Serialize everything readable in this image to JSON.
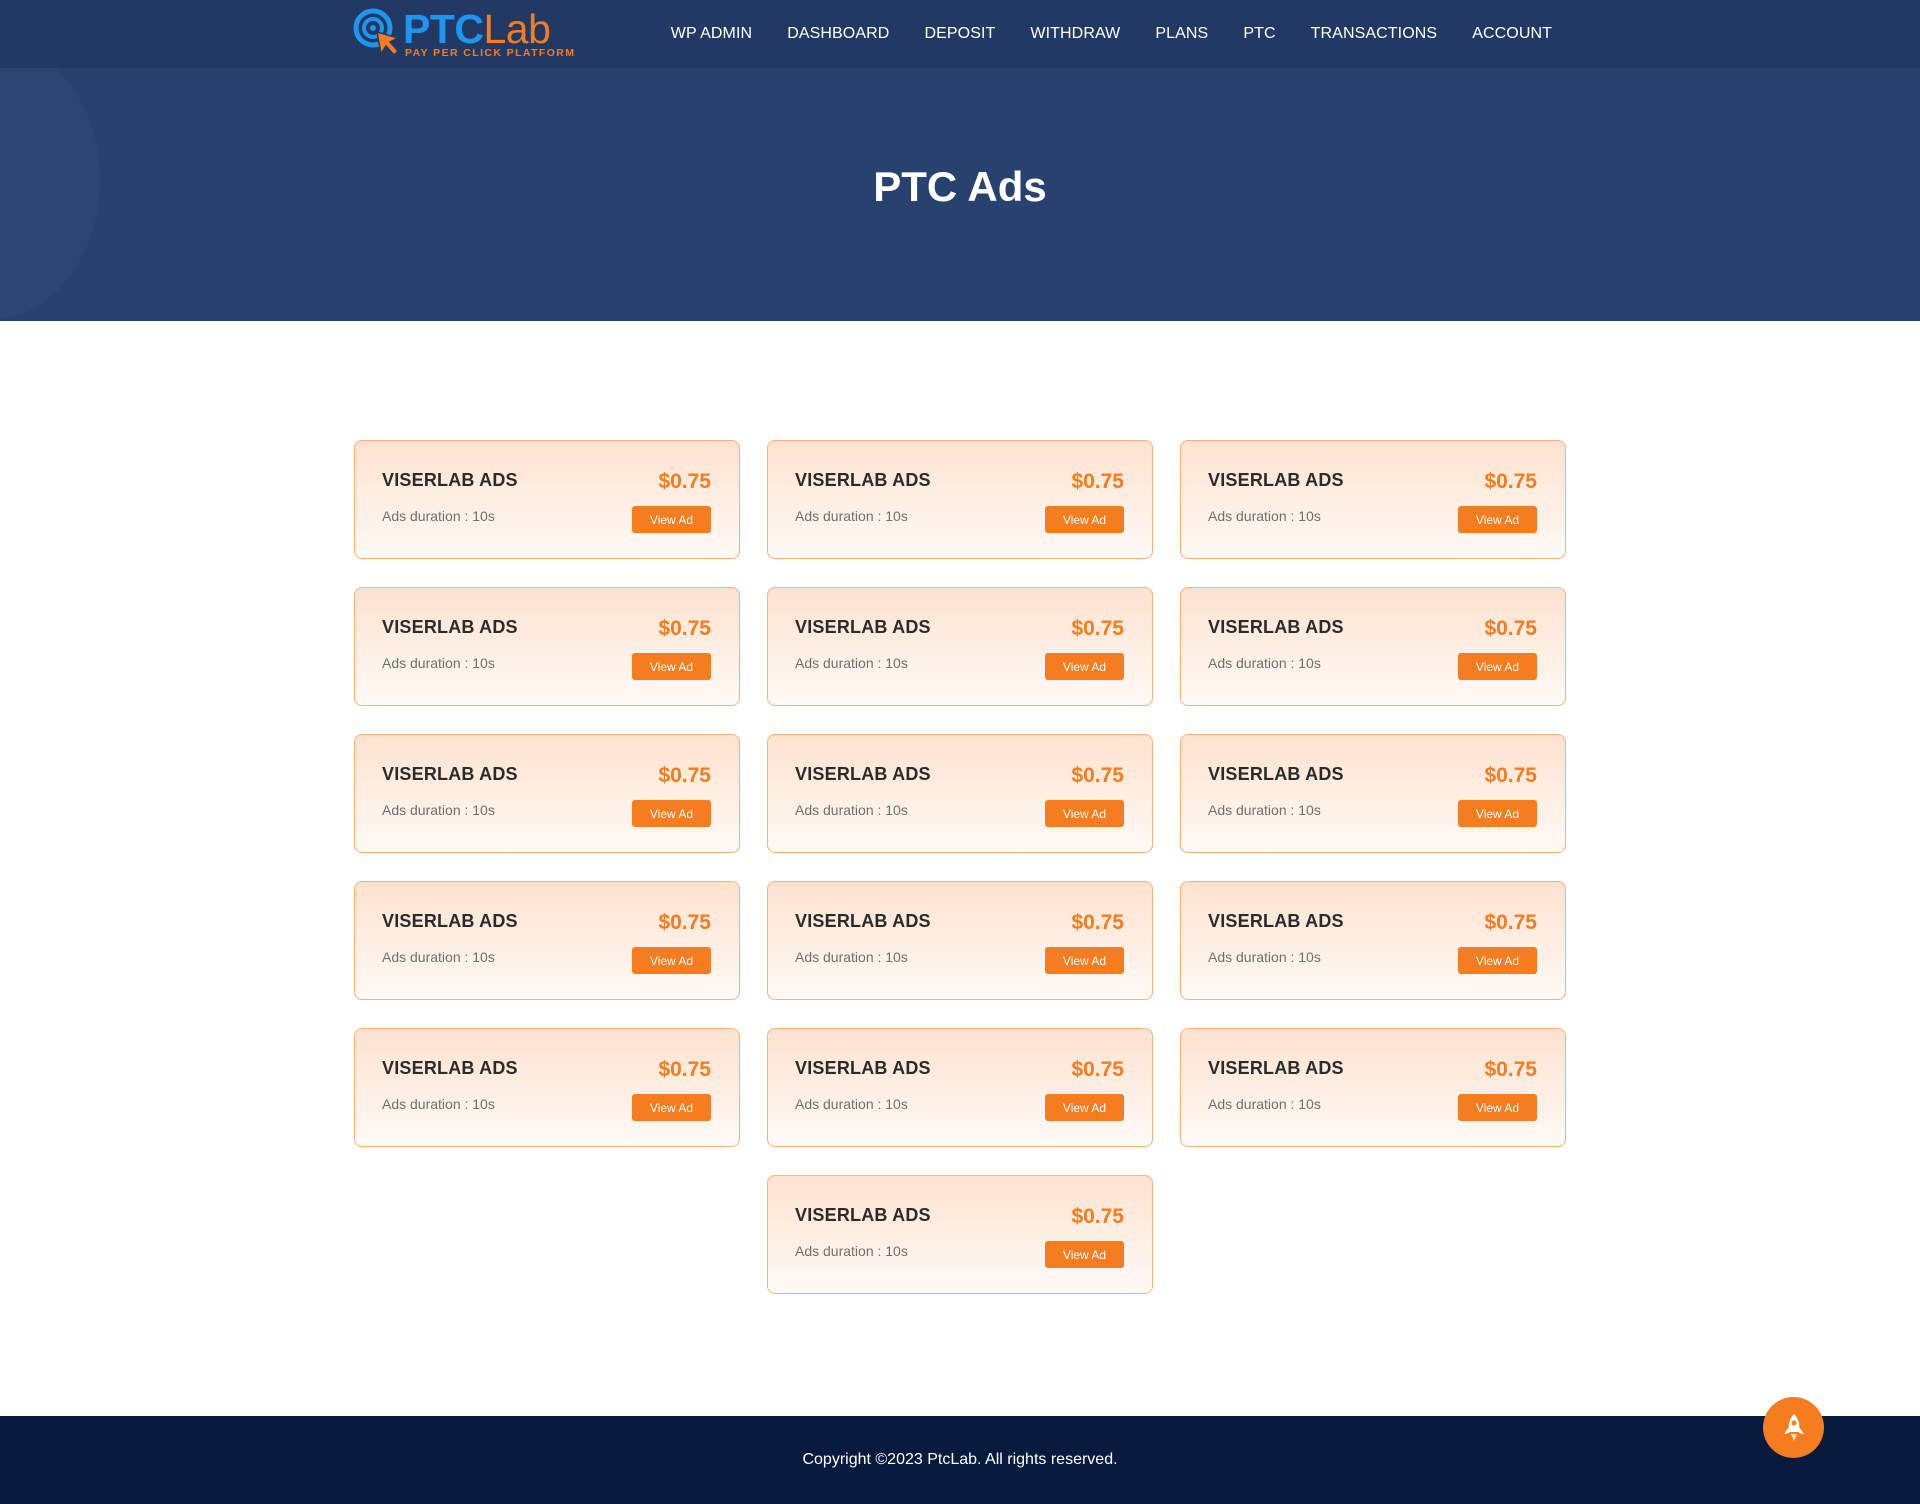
{
  "brand": {
    "name_part1": "PTC",
    "name_part2": "Lab",
    "tagline": "PAY PER CLICK PLATFORM",
    "blue": "#1e96f0",
    "orange": "#f57c1f"
  },
  "nav": {
    "items": [
      {
        "label": "WP ADMIN"
      },
      {
        "label": "DASHBOARD"
      },
      {
        "label": "DEPOSIT"
      },
      {
        "label": "WITHDRAW"
      },
      {
        "label": "PLANS"
      },
      {
        "label": "PTC"
      },
      {
        "label": "TRANSACTIONS"
      },
      {
        "label": "ACCOUNT"
      }
    ]
  },
  "hero": {
    "title": "PTC Ads"
  },
  "ads": [
    {
      "title": "VISERLAB ADS",
      "duration": "Ads duration : 10s",
      "price": "$0.75",
      "button": "View Ad"
    },
    {
      "title": "VISERLAB ADS",
      "duration": "Ads duration : 10s",
      "price": "$0.75",
      "button": "View Ad"
    },
    {
      "title": "VISERLAB ADS",
      "duration": "Ads duration : 10s",
      "price": "$0.75",
      "button": "View Ad"
    },
    {
      "title": "VISERLAB ADS",
      "duration": "Ads duration : 10s",
      "price": "$0.75",
      "button": "View Ad"
    },
    {
      "title": "VISERLAB ADS",
      "duration": "Ads duration : 10s",
      "price": "$0.75",
      "button": "View Ad"
    },
    {
      "title": "VISERLAB ADS",
      "duration": "Ads duration : 10s",
      "price": "$0.75",
      "button": "View Ad"
    },
    {
      "title": "VISERLAB ADS",
      "duration": "Ads duration : 10s",
      "price": "$0.75",
      "button": "View Ad"
    },
    {
      "title": "VISERLAB ADS",
      "duration": "Ads duration : 10s",
      "price": "$0.75",
      "button": "View Ad"
    },
    {
      "title": "VISERLAB ADS",
      "duration": "Ads duration : 10s",
      "price": "$0.75",
      "button": "View Ad"
    },
    {
      "title": "VISERLAB ADS",
      "duration": "Ads duration : 10s",
      "price": "$0.75",
      "button": "View Ad"
    },
    {
      "title": "VISERLAB ADS",
      "duration": "Ads duration : 10s",
      "price": "$0.75",
      "button": "View Ad"
    },
    {
      "title": "VISERLAB ADS",
      "duration": "Ads duration : 10s",
      "price": "$0.75",
      "button": "View Ad"
    },
    {
      "title": "VISERLAB ADS",
      "duration": "Ads duration : 10s",
      "price": "$0.75",
      "button": "View Ad"
    },
    {
      "title": "VISERLAB ADS",
      "duration": "Ads duration : 10s",
      "price": "$0.75",
      "button": "View Ad"
    },
    {
      "title": "VISERLAB ADS",
      "duration": "Ads duration : 10s",
      "price": "$0.75",
      "button": "View Ad"
    },
    {
      "title": "VISERLAB ADS",
      "duration": "Ads duration : 10s",
      "price": "$0.75",
      "button": "View Ad"
    }
  ],
  "footer": {
    "copyright": "Copyright ©2023 PtcLab. All rights reserved."
  },
  "icons": {
    "logo_mark": "target-cursor-icon",
    "scroll_top": "rocket-icon"
  },
  "colors": {
    "header_bg": "#284270",
    "footer_bg": "#081a3e",
    "accent": "#f57c1f"
  }
}
